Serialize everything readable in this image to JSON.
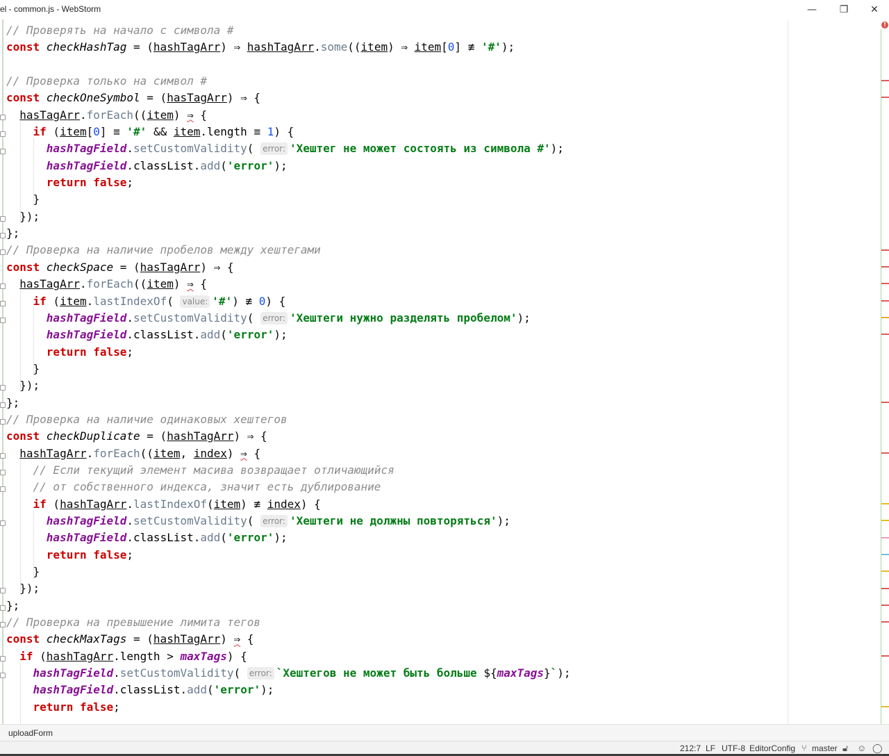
{
  "window": {
    "title": "el - common.js - WebStorm",
    "minimize_glyph": "—",
    "maximize_glyph": "❐",
    "close_glyph": "✕"
  },
  "editor": {
    "file": "common.js",
    "lines": [
      [
        {
          "c": "cmt",
          "t": "// Проверять на начало с символа #"
        }
      ],
      [
        {
          "c": "kw",
          "t": "const "
        },
        {
          "c": "fn",
          "t": "checkHashTag"
        },
        {
          "t": " = ("
        },
        {
          "c": "ul",
          "t": "hashTagArr"
        },
        {
          "t": ") ⇒ "
        },
        {
          "c": "ul",
          "t": "hashTagArr"
        },
        {
          "t": "."
        },
        {
          "c": "mth",
          "t": "some"
        },
        {
          "t": "(("
        },
        {
          "c": "ul",
          "t": "item"
        },
        {
          "t": ") ⇒ "
        },
        {
          "c": "ul",
          "t": "item"
        },
        {
          "t": "["
        },
        {
          "c": "num",
          "t": "0"
        },
        {
          "t": "] ≢ "
        },
        {
          "c": "str",
          "t": "'#'"
        },
        {
          "t": ");"
        }
      ],
      [],
      [
        {
          "c": "cmt",
          "t": "// Проверка только на символ #"
        }
      ],
      [
        {
          "c": "kw",
          "t": "const "
        },
        {
          "c": "fn",
          "t": "checkOneSymbol"
        },
        {
          "t": " = ("
        },
        {
          "c": "ul",
          "t": "hasTagArr"
        },
        {
          "t": ") ⇒ {"
        }
      ],
      [
        {
          "t": "  "
        },
        {
          "c": "ul",
          "t": "hasTagArr"
        },
        {
          "t": "."
        },
        {
          "c": "mth",
          "t": "forEach"
        },
        {
          "t": "(("
        },
        {
          "c": "ul",
          "t": "item"
        },
        {
          "t": ") "
        },
        {
          "c": "warn",
          "t": "⇒"
        },
        {
          "t": " {"
        }
      ],
      [
        {
          "t": "    "
        },
        {
          "c": "kw",
          "t": "if"
        },
        {
          "t": " ("
        },
        {
          "c": "ul",
          "t": "item"
        },
        {
          "t": "["
        },
        {
          "c": "num",
          "t": "0"
        },
        {
          "t": "] ≡ "
        },
        {
          "c": "str",
          "t": "'#'"
        },
        {
          "t": " && "
        },
        {
          "c": "ul",
          "t": "item"
        },
        {
          "t": "."
        },
        {
          "c": "prop",
          "t": "length"
        },
        {
          "t": " ≡ "
        },
        {
          "c": "num",
          "t": "1"
        },
        {
          "t": ") {"
        }
      ],
      [
        {
          "t": "      "
        },
        {
          "c": "gv",
          "t": "hashTagField"
        },
        {
          "t": "."
        },
        {
          "c": "mth",
          "t": "setCustomValidity"
        },
        {
          "t": "( "
        },
        {
          "c": "hint",
          "t": "error:"
        },
        {
          "c": "str",
          "t": "'Хештег не может состоять из символа #'"
        },
        {
          "t": ");"
        }
      ],
      [
        {
          "t": "      "
        },
        {
          "c": "gv",
          "t": "hashTagField"
        },
        {
          "t": "."
        },
        {
          "c": "prop",
          "t": "classList"
        },
        {
          "t": "."
        },
        {
          "c": "mth",
          "t": "add"
        },
        {
          "t": "("
        },
        {
          "c": "str",
          "t": "'error'"
        },
        {
          "t": ");"
        }
      ],
      [
        {
          "t": "      "
        },
        {
          "c": "kw",
          "t": "return false"
        },
        {
          "t": ";"
        }
      ],
      [
        {
          "t": "    }"
        }
      ],
      [
        {
          "t": "  });"
        }
      ],
      [
        {
          "t": "};"
        }
      ],
      [
        {
          "c": "cmt",
          "t": "// Проверка на наличие пробелов между хештегами"
        }
      ],
      [
        {
          "c": "kw",
          "t": "const "
        },
        {
          "c": "fn",
          "t": "checkSpace"
        },
        {
          "t": " = ("
        },
        {
          "c": "ul",
          "t": "hasTagArr"
        },
        {
          "t": ") ⇒ {"
        }
      ],
      [
        {
          "t": "  "
        },
        {
          "c": "ul",
          "t": "hasTagArr"
        },
        {
          "t": "."
        },
        {
          "c": "mth",
          "t": "forEach"
        },
        {
          "t": "(("
        },
        {
          "c": "ul",
          "t": "item"
        },
        {
          "t": ") "
        },
        {
          "c": "warn",
          "t": "⇒"
        },
        {
          "t": " {"
        }
      ],
      [
        {
          "t": "    "
        },
        {
          "c": "kw",
          "t": "if"
        },
        {
          "t": " ("
        },
        {
          "c": "ul",
          "t": "item"
        },
        {
          "t": "."
        },
        {
          "c": "mth",
          "t": "lastIndexOf"
        },
        {
          "t": "( "
        },
        {
          "c": "hint",
          "t": "value:"
        },
        {
          "c": "str",
          "t": "'#'"
        },
        {
          "t": ") ≢ "
        },
        {
          "c": "num",
          "t": "0"
        },
        {
          "t": ") {"
        }
      ],
      [
        {
          "t": "      "
        },
        {
          "c": "gv",
          "t": "hashTagField"
        },
        {
          "t": "."
        },
        {
          "c": "mth",
          "t": "setCustomValidity"
        },
        {
          "t": "( "
        },
        {
          "c": "hint",
          "t": "error:"
        },
        {
          "c": "str",
          "t": "'Хештеги нужно разделять пробелом'"
        },
        {
          "t": ");"
        }
      ],
      [
        {
          "t": "      "
        },
        {
          "c": "gv",
          "t": "hashTagField"
        },
        {
          "t": "."
        },
        {
          "c": "prop",
          "t": "classList"
        },
        {
          "t": "."
        },
        {
          "c": "mth",
          "t": "add"
        },
        {
          "t": "("
        },
        {
          "c": "str",
          "t": "'error'"
        },
        {
          "t": ");"
        }
      ],
      [
        {
          "t": "      "
        },
        {
          "c": "kw",
          "t": "return false"
        },
        {
          "t": ";"
        }
      ],
      [
        {
          "t": "    }"
        }
      ],
      [
        {
          "t": "  });"
        }
      ],
      [
        {
          "t": "};"
        }
      ],
      [
        {
          "c": "cmt",
          "t": "// Проверка на наличие одинаковых хештегов"
        }
      ],
      [
        {
          "c": "kw",
          "t": "const "
        },
        {
          "c": "fn",
          "t": "checkDuplicate"
        },
        {
          "t": " = ("
        },
        {
          "c": "ul",
          "t": "hashTagArr"
        },
        {
          "t": ") ⇒ {"
        }
      ],
      [
        {
          "t": "  "
        },
        {
          "c": "ul",
          "t": "hashTagArr"
        },
        {
          "t": "."
        },
        {
          "c": "mth",
          "t": "forEach"
        },
        {
          "t": "(("
        },
        {
          "c": "ul",
          "t": "item"
        },
        {
          "t": ", "
        },
        {
          "c": "ul",
          "t": "index"
        },
        {
          "t": ") "
        },
        {
          "c": "warn",
          "t": "⇒"
        },
        {
          "t": " {"
        }
      ],
      [
        {
          "t": "    "
        },
        {
          "c": "cmt",
          "t": "// Если текущий элемент масива возвращает отличающийся"
        }
      ],
      [
        {
          "t": "    "
        },
        {
          "c": "cmt",
          "t": "// от собственного индекса, значит есть дублирование"
        }
      ],
      [
        {
          "t": "    "
        },
        {
          "c": "kw",
          "t": "if"
        },
        {
          "t": " ("
        },
        {
          "c": "ul",
          "t": "hashTagArr"
        },
        {
          "t": "."
        },
        {
          "c": "mth",
          "t": "lastIndexOf"
        },
        {
          "t": "("
        },
        {
          "c": "ul",
          "t": "item"
        },
        {
          "t": ") ≢ "
        },
        {
          "c": "ul",
          "t": "index"
        },
        {
          "t": ") {"
        }
      ],
      [
        {
          "t": "      "
        },
        {
          "c": "gv",
          "t": "hashTagField"
        },
        {
          "t": "."
        },
        {
          "c": "mth",
          "t": "setCustomValidity"
        },
        {
          "t": "( "
        },
        {
          "c": "hint",
          "t": "error:"
        },
        {
          "c": "str",
          "t": "'Хештеги не должны повторяться'"
        },
        {
          "t": ");"
        }
      ],
      [
        {
          "t": "      "
        },
        {
          "c": "gv",
          "t": "hashTagField"
        },
        {
          "t": "."
        },
        {
          "c": "prop",
          "t": "classList"
        },
        {
          "t": "."
        },
        {
          "c": "mth",
          "t": "add"
        },
        {
          "t": "("
        },
        {
          "c": "str",
          "t": "'error'"
        },
        {
          "t": ");"
        }
      ],
      [
        {
          "t": "      "
        },
        {
          "c": "kw",
          "t": "return false"
        },
        {
          "t": ";"
        }
      ],
      [
        {
          "t": "    }"
        }
      ],
      [
        {
          "t": "  });"
        }
      ],
      [
        {
          "t": "};"
        }
      ],
      [
        {
          "c": "cmt",
          "t": "// Проверка на превышение лимита тегов"
        }
      ],
      [
        {
          "c": "kw",
          "t": "const "
        },
        {
          "c": "fn",
          "t": "checkMaxTags"
        },
        {
          "t": " = ("
        },
        {
          "c": "ul",
          "t": "hashTagArr"
        },
        {
          "t": ") "
        },
        {
          "c": "warn",
          "t": "⇒"
        },
        {
          "t": " {"
        }
      ],
      [
        {
          "t": "  "
        },
        {
          "c": "kw",
          "t": "if"
        },
        {
          "t": " ("
        },
        {
          "c": "ul",
          "t": "hashTagArr"
        },
        {
          "t": "."
        },
        {
          "c": "prop",
          "t": "length"
        },
        {
          "t": " > "
        },
        {
          "c": "gv",
          "t": "maxTags"
        },
        {
          "t": ") {"
        }
      ],
      [
        {
          "t": "    "
        },
        {
          "c": "gv",
          "t": "hashTagField"
        },
        {
          "t": "."
        },
        {
          "c": "mth",
          "t": "setCustomValidity"
        },
        {
          "t": "( "
        },
        {
          "c": "hint",
          "t": "error:"
        },
        {
          "c": "str",
          "t": "`Хештегов не может быть больше "
        },
        {
          "t": "${"
        },
        {
          "c": "gv",
          "t": "maxTags"
        },
        {
          "t": "}"
        },
        {
          "c": "str",
          "t": "`"
        },
        {
          "t": ");"
        }
      ],
      [
        {
          "t": "    "
        },
        {
          "c": "gv",
          "t": "hashTagField"
        },
        {
          "t": "."
        },
        {
          "c": "prop",
          "t": "classList"
        },
        {
          "t": "."
        },
        {
          "c": "mth",
          "t": "add"
        },
        {
          "t": "("
        },
        {
          "c": "str",
          "t": "'error'"
        },
        {
          "t": ");"
        }
      ],
      [
        {
          "t": "    "
        },
        {
          "c": "kw",
          "t": "return false"
        },
        {
          "t": ";"
        }
      ]
    ]
  },
  "stripe_marks": [
    {
      "line": 3,
      "color": "#e05a5a"
    },
    {
      "line": 4,
      "color": "#e05a5a"
    },
    {
      "line": 13,
      "color": "#e05a5a"
    },
    {
      "line": 14,
      "color": "#e05a5a"
    },
    {
      "line": 15,
      "color": "#e05a5a"
    },
    {
      "line": 16,
      "color": "#e05a5a"
    },
    {
      "line": 17,
      "color": "#e0b020"
    },
    {
      "line": 18,
      "color": "#e05a5a"
    },
    {
      "line": 22,
      "color": "#e05a5a"
    },
    {
      "line": 25,
      "color": "#e05a5a"
    },
    {
      "line": 28,
      "color": "#e0c020"
    },
    {
      "line": 29,
      "color": "#e0c020"
    },
    {
      "line": 30,
      "color": "#e8a0c0"
    },
    {
      "line": 31,
      "color": "#70c0e0"
    },
    {
      "line": 32,
      "color": "#e0c020"
    },
    {
      "line": 33,
      "color": "#e05a5a"
    },
    {
      "line": 34,
      "color": "#e05a5a"
    },
    {
      "line": 35,
      "color": "#e05a5a"
    },
    {
      "line": 37,
      "color": "#e05a5a"
    },
    {
      "line": 40,
      "color": "#e0c020"
    }
  ],
  "breadcrumb": {
    "label": "uploadForm"
  },
  "statusbar": {
    "position": "212:7",
    "line_separator": "LF",
    "encoding": "UTF-8",
    "config": "EditorConfig",
    "branch": "master"
  }
}
